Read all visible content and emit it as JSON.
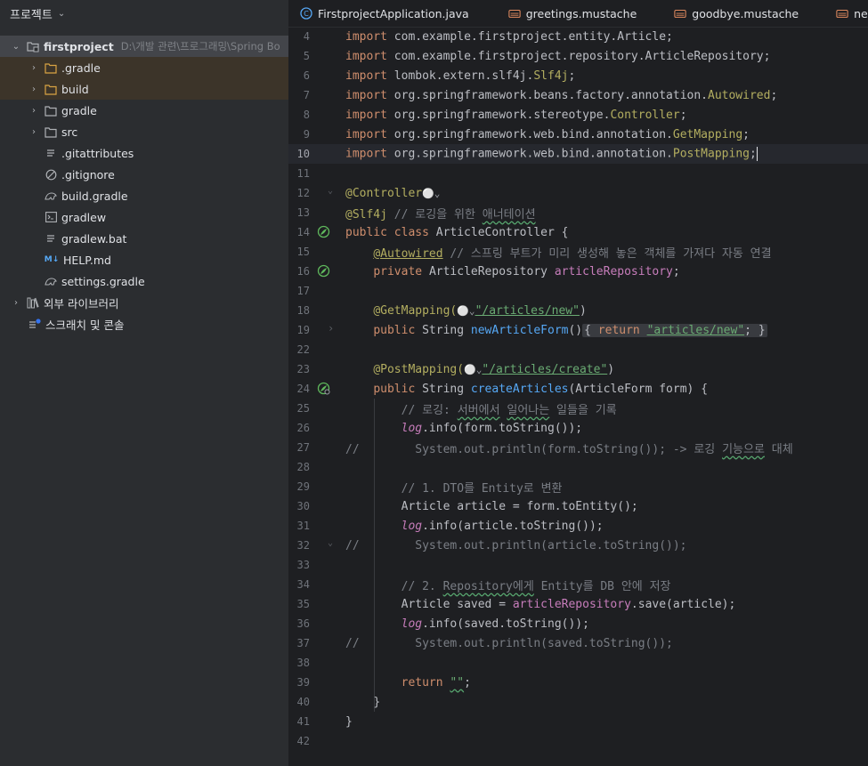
{
  "sidebar": {
    "header": "프로젝트",
    "project": {
      "name": "firstproject",
      "path": "D:\\개발 관련\\프로그래밍\\Spring Bo"
    },
    "items": [
      {
        "label": ".gradle",
        "kind": "folder"
      },
      {
        "label": "build",
        "kind": "folder"
      },
      {
        "label": "gradle",
        "kind": "folder"
      },
      {
        "label": "src",
        "kind": "folder"
      },
      {
        "label": ".gitattributes",
        "kind": "file"
      },
      {
        "label": ".gitignore",
        "kind": "file"
      },
      {
        "label": "build.gradle",
        "kind": "file"
      },
      {
        "label": "gradlew",
        "kind": "file"
      },
      {
        "label": "gradlew.bat",
        "kind": "file"
      },
      {
        "label": "HELP.md",
        "kind": "file"
      },
      {
        "label": "settings.gradle",
        "kind": "file"
      }
    ],
    "external_libs": "외부 라이브러리",
    "scratches": "스크래치 및 콘솔"
  },
  "tabs": [
    {
      "label": "FirstprojectApplication.java"
    },
    {
      "label": "greetings.mustache"
    },
    {
      "label": "goodbye.mustache"
    },
    {
      "label": "new.mustache"
    }
  ],
  "line_numbers": [
    "4",
    "5",
    "6",
    "7",
    "8",
    "9",
    "10",
    "11",
    "12",
    "13",
    "14",
    "15",
    "16",
    "17",
    "18",
    "19",
    "22",
    "23",
    "24",
    "25",
    "26",
    "27",
    "28",
    "29",
    "30",
    "31",
    "32",
    "33",
    "34",
    "35",
    "36",
    "37",
    "38",
    "39",
    "40",
    "41",
    "42"
  ],
  "code": {
    "l4": "import com.example.firstproject.entity.Article;",
    "l5": "import com.example.firstproject.repository.ArticleRepository;",
    "l6a": "import lombok.extern.slf4j.",
    "l6b": "Slf4j",
    "l7a": "import org.springframework.beans.factory.annotation.",
    "l7b": "Autowired",
    "l8a": "import org.springframework.stereotype.",
    "l8b": "Controller",
    "l9a": "import org.springframework.web.bind.annotation.",
    "l9b": "GetMapping",
    "l10a": "import org.springframework.web.bind.annotation.",
    "l10b": "PostMapping",
    "l12": "@Controller",
    "l13a": "@Slf4j",
    "l13b": " // 로깅을 위한 ",
    "l13c": "애너테이션",
    "l14a": "public class ",
    "l14b": "ArticleController {",
    "l15a": "@Autowired",
    "l15b": " // 스프링 부트가 미리 생성해 놓은 객체를 가져다 자동 연결",
    "l16a": "private ",
    "l16b": "ArticleRepository ",
    "l16c": "articleRepository",
    "l18a": "@GetMapping(",
    "l18b": "\"/articles/new\"",
    "l19a": "public ",
    "l19b": "String ",
    "l19c": "newArticleForm",
    "l19d": "()",
    "l19e": "{ ",
    "l19f": "return ",
    "l19g": "\"articles/new\"",
    "l19h": "; }",
    "l23a": "@PostMapping(",
    "l23b": "\"/articles/create\"",
    "l24a": "public ",
    "l24b": "String ",
    "l24c": "createArticles",
    "l24d": "(ArticleForm form) {",
    "l25a": "// 로깅: ",
    "l25b": "서버에서",
    "l25c": " ",
    "l25d": "일어나는",
    "l25e": " 일들을 기록",
    "l26a": "log",
    "l26b": ".info(form.toString());",
    "l27a": "//",
    "l27b": "        System.out.println(form.toString()); -> 로깅 ",
    "l27c": "기능으로",
    "l27d": " 대체",
    "l29": "// 1. DTO를 Entity로 변환",
    "l30a": "Article article = form.",
    "l30b": "toEntity",
    "l30c": "();",
    "l31a": "log",
    "l31b": ".info(article.toString());",
    "l32a": "//",
    "l32b": "        System.out.println(article.toString());",
    "l34a": "// 2. ",
    "l34b": "Repository에게",
    "l34c": " Entity를 DB 안에 저장",
    "l35a": "Article saved = ",
    "l35b": "articleRepository",
    "l35c": ".save(article);",
    "l36a": "log",
    "l36b": ".info(saved.toString());",
    "l37a": "//",
    "l37b": "        System.out.println(saved.toString());",
    "l39a": "return ",
    "l39b": "\"\"",
    "l39c": ";",
    "l40": "}",
    "l41": "}",
    "semi": ";",
    "close": ")"
  }
}
